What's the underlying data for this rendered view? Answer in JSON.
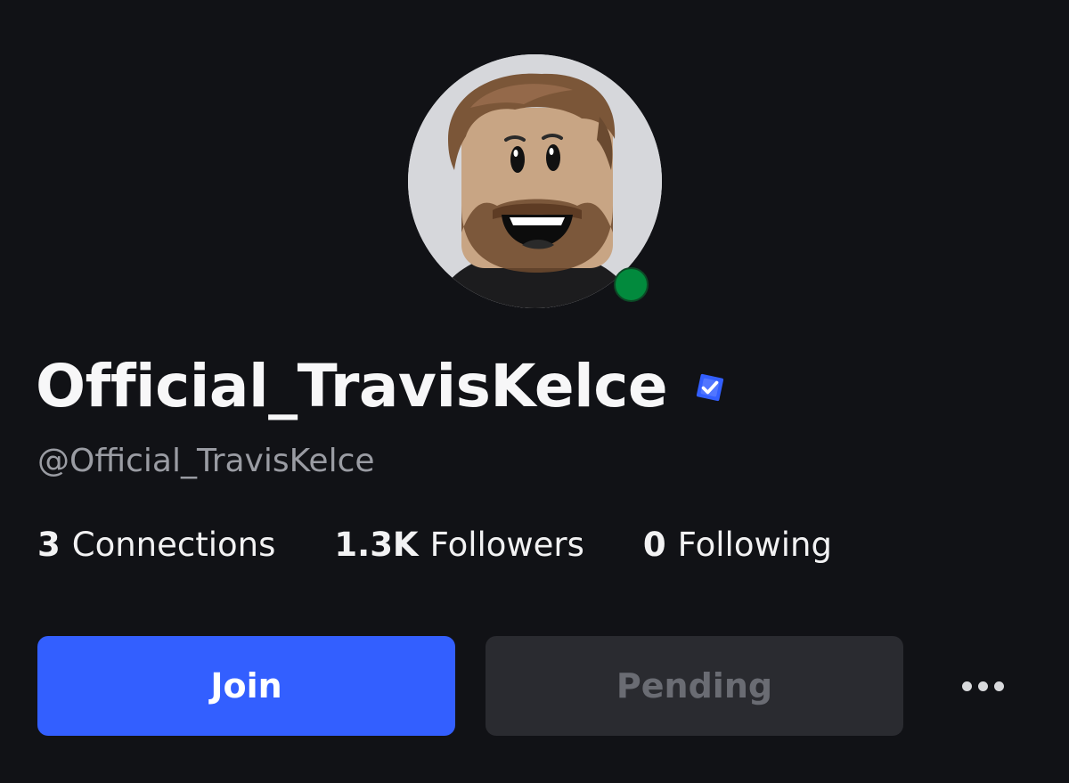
{
  "profile": {
    "display_name": "Official_TravisKelce",
    "username": "@Official_TravisKelce",
    "verified": true,
    "online_status": "online",
    "avatar_icon": "avatar-headshot",
    "verified_icon": "verified-badge-icon"
  },
  "stats": {
    "connections": {
      "count": "3",
      "label": "Connections"
    },
    "followers": {
      "count": "1.3K",
      "label": "Followers"
    },
    "following": {
      "count": "0",
      "label": "Following"
    }
  },
  "actions": {
    "join_label": "Join",
    "pending_label": "Pending",
    "more_icon": "more-horizontal-icon"
  },
  "colors": {
    "background": "#111216",
    "primary_button": "#335fff",
    "disabled_button": "#2a2b30",
    "online_indicator": "#028a3d",
    "verified_badge": "#335fff"
  }
}
